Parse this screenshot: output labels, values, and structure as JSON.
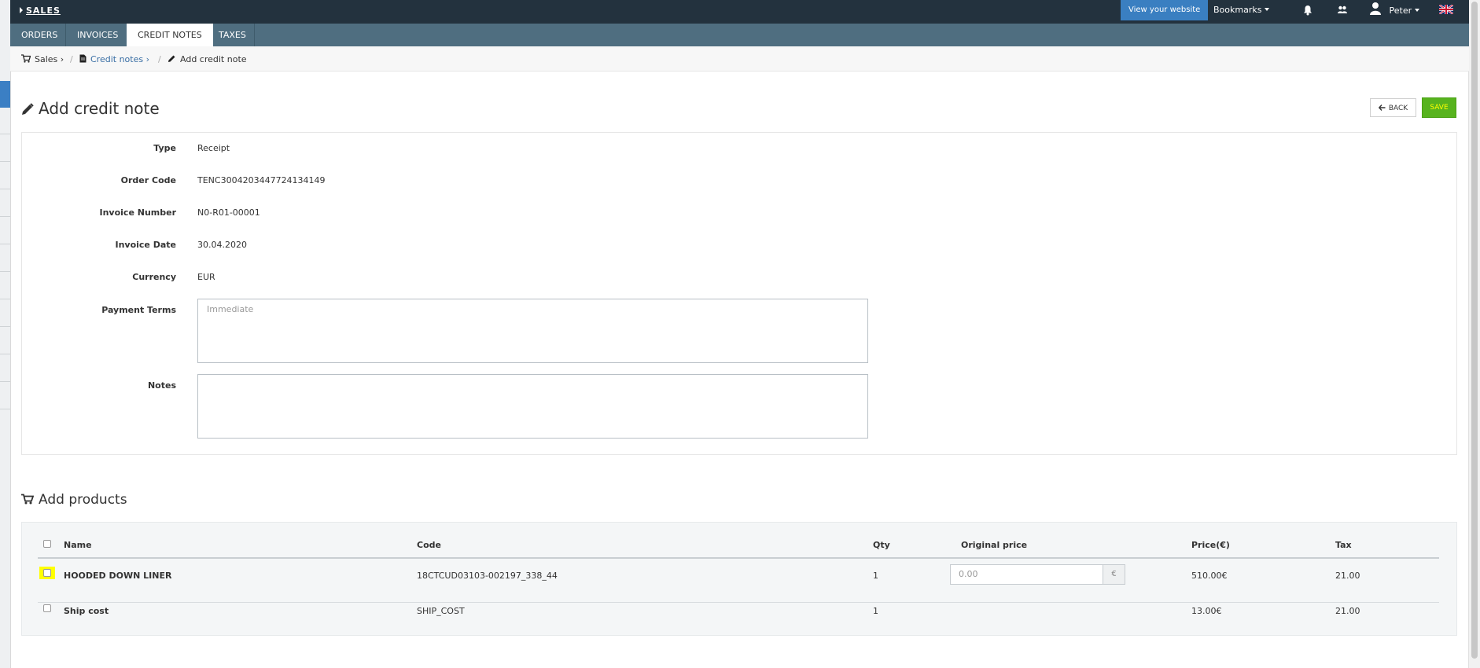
{
  "topbar": {
    "brand": "SALES",
    "view_website": "View your website",
    "bookmarks": "Bookmarks",
    "user": "Peter"
  },
  "tabs": [
    {
      "label": "ORDERS",
      "active": false
    },
    {
      "label": "INVOICES",
      "active": false
    },
    {
      "label": "CREDIT NOTES",
      "active": true
    },
    {
      "label": "TAXES",
      "active": false
    }
  ],
  "breadcrumb": {
    "sales": "Sales",
    "credit_notes": "Credit notes",
    "current": "Add credit note",
    "separator": "/",
    "chevron": "›"
  },
  "page": {
    "title": "Add credit note",
    "back_label": "BACK",
    "save_label": "SAVE"
  },
  "form": {
    "type_label": "Type",
    "type_value": "Receipt",
    "order_code_label": "Order Code",
    "order_code_value": "TENC3004203447724134149",
    "invoice_number_label": "Invoice Number",
    "invoice_number_value": "N0-R01-00001",
    "invoice_date_label": "Invoice Date",
    "invoice_date_value": "30.04.2020",
    "currency_label": "Currency",
    "currency_value": "EUR",
    "payment_terms_label": "Payment Terms",
    "payment_terms_placeholder": "Immediate",
    "notes_label": "Notes",
    "notes_value": ""
  },
  "products": {
    "title": "Add products",
    "columns": {
      "name": "Name",
      "code": "Code",
      "qty": "Qty",
      "original_price": "Original price",
      "price": "Price(€)",
      "tax": "Tax"
    },
    "rows": [
      {
        "name": "HOODED DOWN LINER",
        "code": "18CTCUD03103-002197_338_44",
        "qty": "1",
        "original_price_placeholder": "0.00",
        "currency_addon": "€",
        "price": "510.00€",
        "tax": "21.00",
        "highlighted": true
      },
      {
        "name": "Ship cost",
        "code": "SHIP_COST",
        "qty": "1",
        "price": "13.00€",
        "tax": "21.00",
        "highlighted": false
      }
    ]
  },
  "colors": {
    "topbar": "#23323e",
    "tabbar": "#4f6e80",
    "view_website": "#3a7fc1",
    "save": "#57b31e",
    "highlight": "#ffff00"
  },
  "icons": [
    "caret-right-icon",
    "bell-icon",
    "users-icon",
    "user-icon",
    "uk-flag-icon",
    "cart-icon",
    "document-icon",
    "pencil-icon",
    "arrow-left-icon"
  ]
}
